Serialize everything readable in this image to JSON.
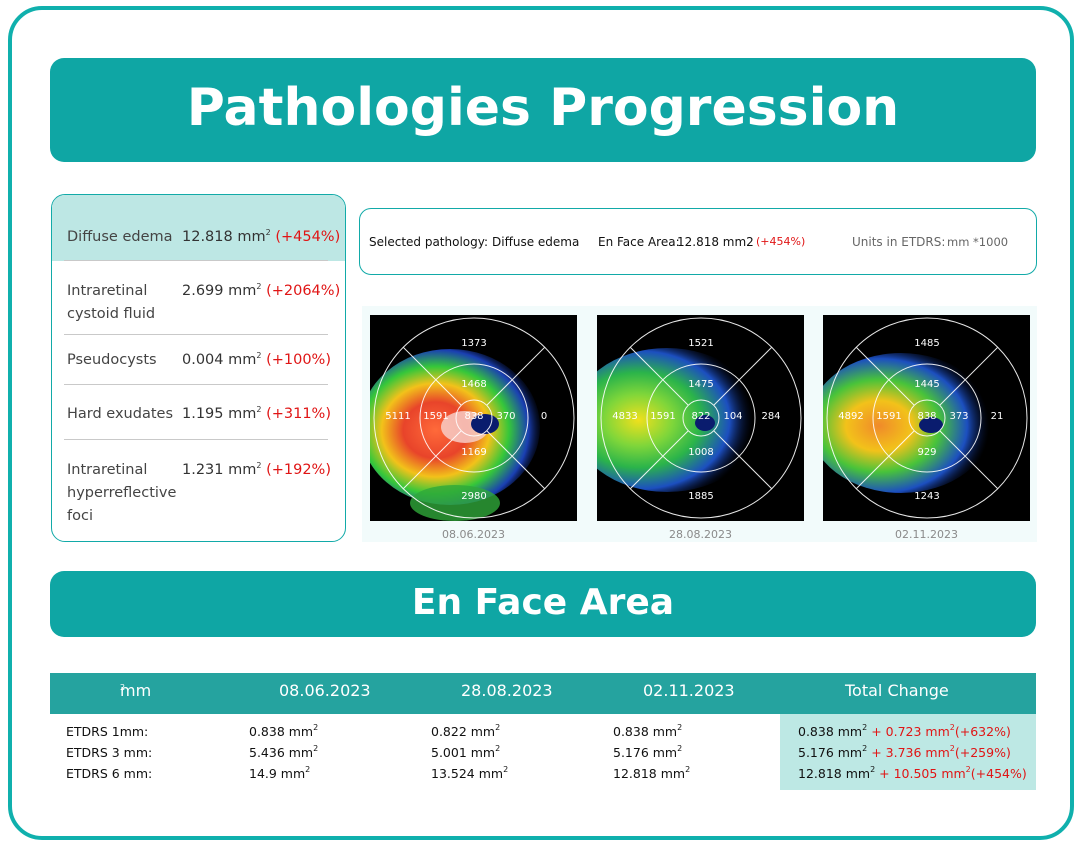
{
  "title": "Pathologies Progression",
  "pathologies": [
    {
      "name": "Diffuse edema",
      "value": "12.818 mm",
      "change": "(+454%)",
      "selected": true
    },
    {
      "name": "Intraretinal cystoid fluid",
      "value": "2.699 mm",
      "change": "(+2064%)"
    },
    {
      "name": "Pseudocysts",
      "value": "0.004 mm",
      "change": "(+100%)"
    },
    {
      "name": "Hard exudates",
      "value": "1.195 mm",
      "change": "(+311%)"
    },
    {
      "name": "Intraretinal hyperreflective foci",
      "value": "1.231 mm",
      "change": "(+192%)"
    }
  ],
  "info": {
    "selected_label": "Selected pathology:",
    "selected_value": "Diffuse edema",
    "area_label": "En Face Area:",
    "area_value": "12.818 mm2",
    "area_change": "(+454%)",
    "units_label": "Units in ETDRS:",
    "units_value": "mm *1000"
  },
  "maps": [
    {
      "date": "08.06.2023",
      "values": {
        "top_outer": "1373",
        "top_inner": "1468",
        "left_outer": "5111",
        "left_inner": "1591",
        "center": "838",
        "right_inner": "370",
        "right_outer": "0",
        "bottom_inner": "1169",
        "bottom_outer": "2980"
      }
    },
    {
      "date": "28.08.2023",
      "values": {
        "top_outer": "1521",
        "top_inner": "1475",
        "left_outer": "4833",
        "left_inner": "1591",
        "center": "822",
        "right_inner": "104",
        "right_outer": "284",
        "bottom_inner": "1008",
        "bottom_outer": "1885"
      }
    },
    {
      "date": "02.11.2023",
      "values": {
        "top_outer": "1485",
        "top_inner": "1445",
        "left_outer": "4892",
        "left_inner": "1591",
        "center": "838",
        "right_inner": "373",
        "right_outer": "21",
        "bottom_inner": "929",
        "bottom_outer": "1243"
      }
    }
  ],
  "section_title": "En Face Area",
  "table": {
    "unit_header": "mm",
    "unit_sup": "2",
    "date_headers": [
      "08.06.2023",
      "28.08.2023",
      "02.11.2023"
    ],
    "total_header": "Total Change",
    "rows": [
      {
        "label": "ETDRS 1mm:",
        "values": [
          "0.838 mm",
          "0.822 mm",
          "0.838 mm"
        ],
        "total": "0.838 mm",
        "delta": "+ 0.723 mm",
        "pct": "(+632%)"
      },
      {
        "label": "ETDRS 3 mm:",
        "values": [
          "5.436 mm",
          "5.001 mm",
          "5.176 mm"
        ],
        "total": "5.176 mm",
        "delta": "+ 3.736 mm",
        "pct": "(+259%)"
      },
      {
        "label": "ETDRS 6 mm:",
        "values": [
          "14.9 mm",
          "13.524 mm",
          "12.818 mm"
        ],
        "total": "12.818 mm",
        "delta": "+ 10.505 mm",
        "pct": "(+454%)"
      }
    ]
  },
  "colors": {
    "teal": "#0fa6a4",
    "header_teal": "#25a39f",
    "highlight": "#bde7e4",
    "increase_red": "#e01515"
  }
}
